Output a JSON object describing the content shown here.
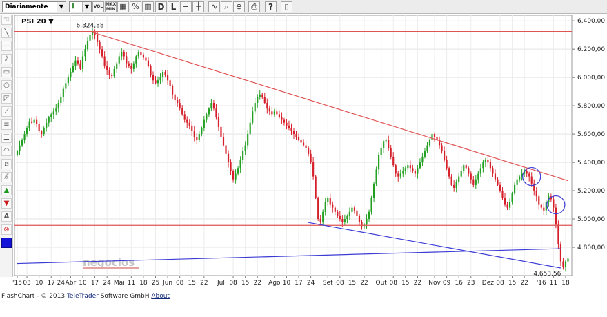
{
  "toolbar": {
    "period_value": "Diariamente",
    "chart_type_value": "",
    "volume_label": "VOL",
    "maxmin_top": "MAX",
    "maxmin_bottom": "MIN",
    "percent_label": "%",
    "d_label": "D",
    "l_label": "L",
    "question_label": "?"
  },
  "palette": {
    "text_tool_label": "A"
  },
  "chart_data": {
    "type": "candlestick",
    "title": "PSI 20",
    "title_caret": "▼",
    "ylim": [
      4600,
      6440
    ],
    "y_ticks": [
      6400,
      6200,
      6000,
      5800,
      5600,
      5400,
      5200,
      5000,
      4800
    ],
    "y_tick_labels": [
      "6.400,00",
      "6.200,00",
      "6.000,00",
      "5.800,00",
      "5.600,00",
      "5.400,00",
      "5.200,00",
      "5.000,00",
      "4.800,00"
    ],
    "x_labels": [
      {
        "label": "'15",
        "bar": 0
      },
      {
        "label": "03",
        "bar": 4
      },
      {
        "label": "10",
        "bar": 9
      },
      {
        "label": "17",
        "bar": 14
      },
      {
        "label": "24",
        "bar": 18
      },
      {
        "label": "Abr",
        "bar": 22
      },
      {
        "label": "10",
        "bar": 27
      },
      {
        "label": "17",
        "bar": 32
      },
      {
        "label": "24",
        "bar": 37
      },
      {
        "label": "Mai",
        "bar": 42
      },
      {
        "label": "11",
        "bar": 47
      },
      {
        "label": "18",
        "bar": 52
      },
      {
        "label": "25",
        "bar": 57
      },
      {
        "label": "Jun",
        "bar": 62
      },
      {
        "label": "08",
        "bar": 67
      },
      {
        "label": "15",
        "bar": 72
      },
      {
        "label": "22",
        "bar": 77
      },
      {
        "label": "Jul",
        "bar": 84
      },
      {
        "label": "08",
        "bar": 89
      },
      {
        "label": "15",
        "bar": 94
      },
      {
        "label": "22",
        "bar": 99
      },
      {
        "label": "Ago",
        "bar": 106
      },
      {
        "label": "10",
        "bar": 111
      },
      {
        "label": "17",
        "bar": 116
      },
      {
        "label": "24",
        "bar": 121
      },
      {
        "label": "Set",
        "bar": 128
      },
      {
        "label": "08",
        "bar": 133
      },
      {
        "label": "15",
        "bar": 138
      },
      {
        "label": "22",
        "bar": 143
      },
      {
        "label": "Out",
        "bar": 150
      },
      {
        "label": "08",
        "bar": 155
      },
      {
        "label": "15",
        "bar": 160
      },
      {
        "label": "22",
        "bar": 165
      },
      {
        "label": "Nov",
        "bar": 172
      },
      {
        "label": "09",
        "bar": 177
      },
      {
        "label": "16",
        "bar": 182
      },
      {
        "label": "23",
        "bar": 187
      },
      {
        "label": "Dez",
        "bar": 194
      },
      {
        "label": "08",
        "bar": 199
      },
      {
        "label": "15",
        "bar": 204
      },
      {
        "label": "22",
        "bar": 209
      },
      {
        "label": "'16",
        "bar": 216
      },
      {
        "label": "11",
        "bar": 221
      },
      {
        "label": "18",
        "bar": 226
      }
    ],
    "bar_count": 228,
    "closes": [
      5480,
      5520,
      5560,
      5600,
      5640,
      5690,
      5680,
      5700,
      5670,
      5620,
      5600,
      5640,
      5680,
      5720,
      5740,
      5760,
      5780,
      5820,
      5860,
      5920,
      5960,
      6000,
      6040,
      6080,
      6120,
      6100,
      6060,
      6150,
      6200,
      6260,
      6300,
      6324,
      6300,
      6250,
      6200,
      6150,
      6080,
      6050,
      6020,
      6010,
      6060,
      6100,
      6150,
      6180,
      6150,
      6100,
      6080,
      6060,
      6100,
      6150,
      6180,
      6160,
      6140,
      6120,
      6080,
      6020,
      5980,
      5960,
      5980,
      6000,
      6040,
      6020,
      5980,
      5940,
      5880,
      5840,
      5820,
      5780,
      5740,
      5700,
      5680,
      5660,
      5620,
      5580,
      5560,
      5600,
      5640,
      5700,
      5740,
      5780,
      5820,
      5780,
      5720,
      5650,
      5580,
      5520,
      5460,
      5400,
      5340,
      5280,
      5320,
      5360,
      5420,
      5480,
      5520,
      5600,
      5680,
      5760,
      5820,
      5860,
      5880,
      5860,
      5820,
      5780,
      5760,
      5740,
      5760,
      5740,
      5720,
      5700,
      5680,
      5660,
      5640,
      5620,
      5600,
      5580,
      5560,
      5540,
      5520,
      5500,
      5460,
      5400,
      5300,
      5150,
      5000,
      4980,
      5050,
      5120,
      5150,
      5100,
      5080,
      5050,
      5020,
      5000,
      4980,
      5000,
      5020,
      5050,
      5080,
      5060,
      5020,
      4980,
      4950,
      4960,
      5000,
      5050,
      5150,
      5250,
      5350,
      5450,
      5500,
      5550,
      5560,
      5500,
      5440,
      5380,
      5320,
      5300,
      5320,
      5340,
      5360,
      5380,
      5360,
      5340,
      5320,
      5360,
      5400,
      5440,
      5480,
      5520,
      5560,
      5600,
      5580,
      5560,
      5520,
      5480,
      5420,
      5360,
      5300,
      5240,
      5220,
      5260,
      5300,
      5340,
      5380,
      5360,
      5320,
      5280,
      5240,
      5280,
      5320,
      5360,
      5400,
      5420,
      5400,
      5360,
      5320,
      5280,
      5240,
      5200,
      5150,
      5100,
      5080,
      5120,
      5180,
      5240,
      5280,
      5300,
      5320,
      5340,
      5320,
      5300,
      5250,
      5200,
      5160,
      5100,
      5080,
      5060,
      5120,
      5160,
      5140,
      5080,
      4960,
      4820,
      4700,
      4660,
      4700,
      4720
    ],
    "resistance_horizontal": 6324.88,
    "support_horizontal": 4955,
    "trend_down_upper": {
      "from": [
        30,
        6324.88
      ],
      "to": [
        227,
        5270
      ]
    },
    "trend_lower_blue": {
      "from": [
        120,
        4975
      ],
      "to": [
        224,
        4653.56
      ]
    },
    "trend_long_blue": {
      "from": [
        0,
        4685
      ],
      "to": [
        224,
        4790
      ]
    },
    "circle_marks": [
      {
        "bar": 212,
        "value": 5300
      },
      {
        "bar": 222,
        "value": 5100
      }
    ],
    "annotations": [
      {
        "text": "6.324,88",
        "bar": 30,
        "value": 6324.88
      },
      {
        "text": "4.653,56",
        "bar": 223,
        "value": 4653.56
      }
    ],
    "up_color": "#22a022",
    "down_color": "#d61f2a",
    "resistance_color": "#e05454",
    "trend_blue_color": "#3b3bd6",
    "watermark": "negocios",
    "grid": true
  },
  "footer": {
    "prefix": "FlashChart - © 2013",
    "brand": "TeleTrader",
    "suffix": "Software GmbH",
    "about_link": "About"
  }
}
